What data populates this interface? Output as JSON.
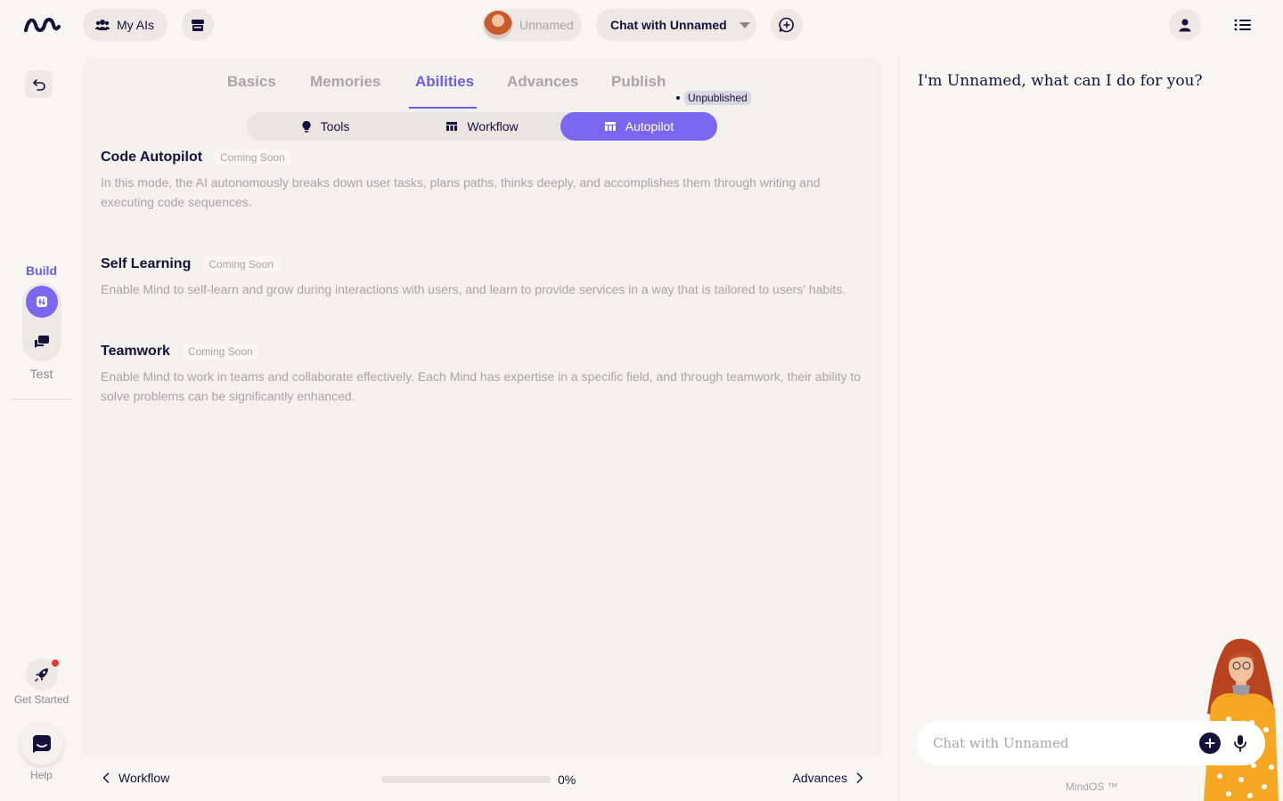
{
  "header": {
    "my_ais_label": "My AIs",
    "agent_name": "Unnamed",
    "chat_selector_label": "Chat with Unnamed"
  },
  "rail": {
    "build_label": "Build",
    "test_label": "Test",
    "get_started_label": "Get Started",
    "help_label": "Help"
  },
  "tabs": [
    {
      "label": "Basics"
    },
    {
      "label": "Memories"
    },
    {
      "label": "Abilities",
      "active": true
    },
    {
      "label": "Advances"
    },
    {
      "label": "Publish"
    }
  ],
  "publish_status": "Unpublished",
  "segments": [
    {
      "label": "Tools",
      "icon": "bulb-icon"
    },
    {
      "label": "Workflow",
      "icon": "table-icon"
    },
    {
      "label": "Autopilot",
      "icon": "autopilot-icon",
      "active": true
    }
  ],
  "abilities": [
    {
      "title": "Code Autopilot",
      "badge": "Coming Soon",
      "description": "In this mode, the AI autonomously breaks down user tasks, plans paths, thinks deeply, and accomplishes them through writing and executing code sequences."
    },
    {
      "title": "Self Learning",
      "badge": "Coming Soon",
      "description": "Enable Mind to self-learn and grow during interactions with users, and learn to provide services in a way that is tailored to users' habits."
    },
    {
      "title": "Teamwork",
      "badge": "Coming Soon",
      "description": "Enable Mind to work in teams and collaborate effectively. Each Mind has expertise in a specific field, and through teamwork, their ability to solve problems can be significantly enhanced."
    }
  ],
  "footer_nav": {
    "prev_label": "Workflow",
    "next_label": "Advances",
    "progress_text": "0%",
    "progress_value": 0
  },
  "chat": {
    "greeting": "I'm Unnamed, what can I do for you?",
    "input_placeholder": "Chat with Unnamed",
    "brand": "MindOS ™"
  },
  "colors": {
    "accent": "#7b66f0",
    "background": "#f8f6f2",
    "panel": "#f3f1ed",
    "text_primary": "#14123a",
    "text_muted": "#a7a4ab",
    "notification": "#e53935"
  }
}
